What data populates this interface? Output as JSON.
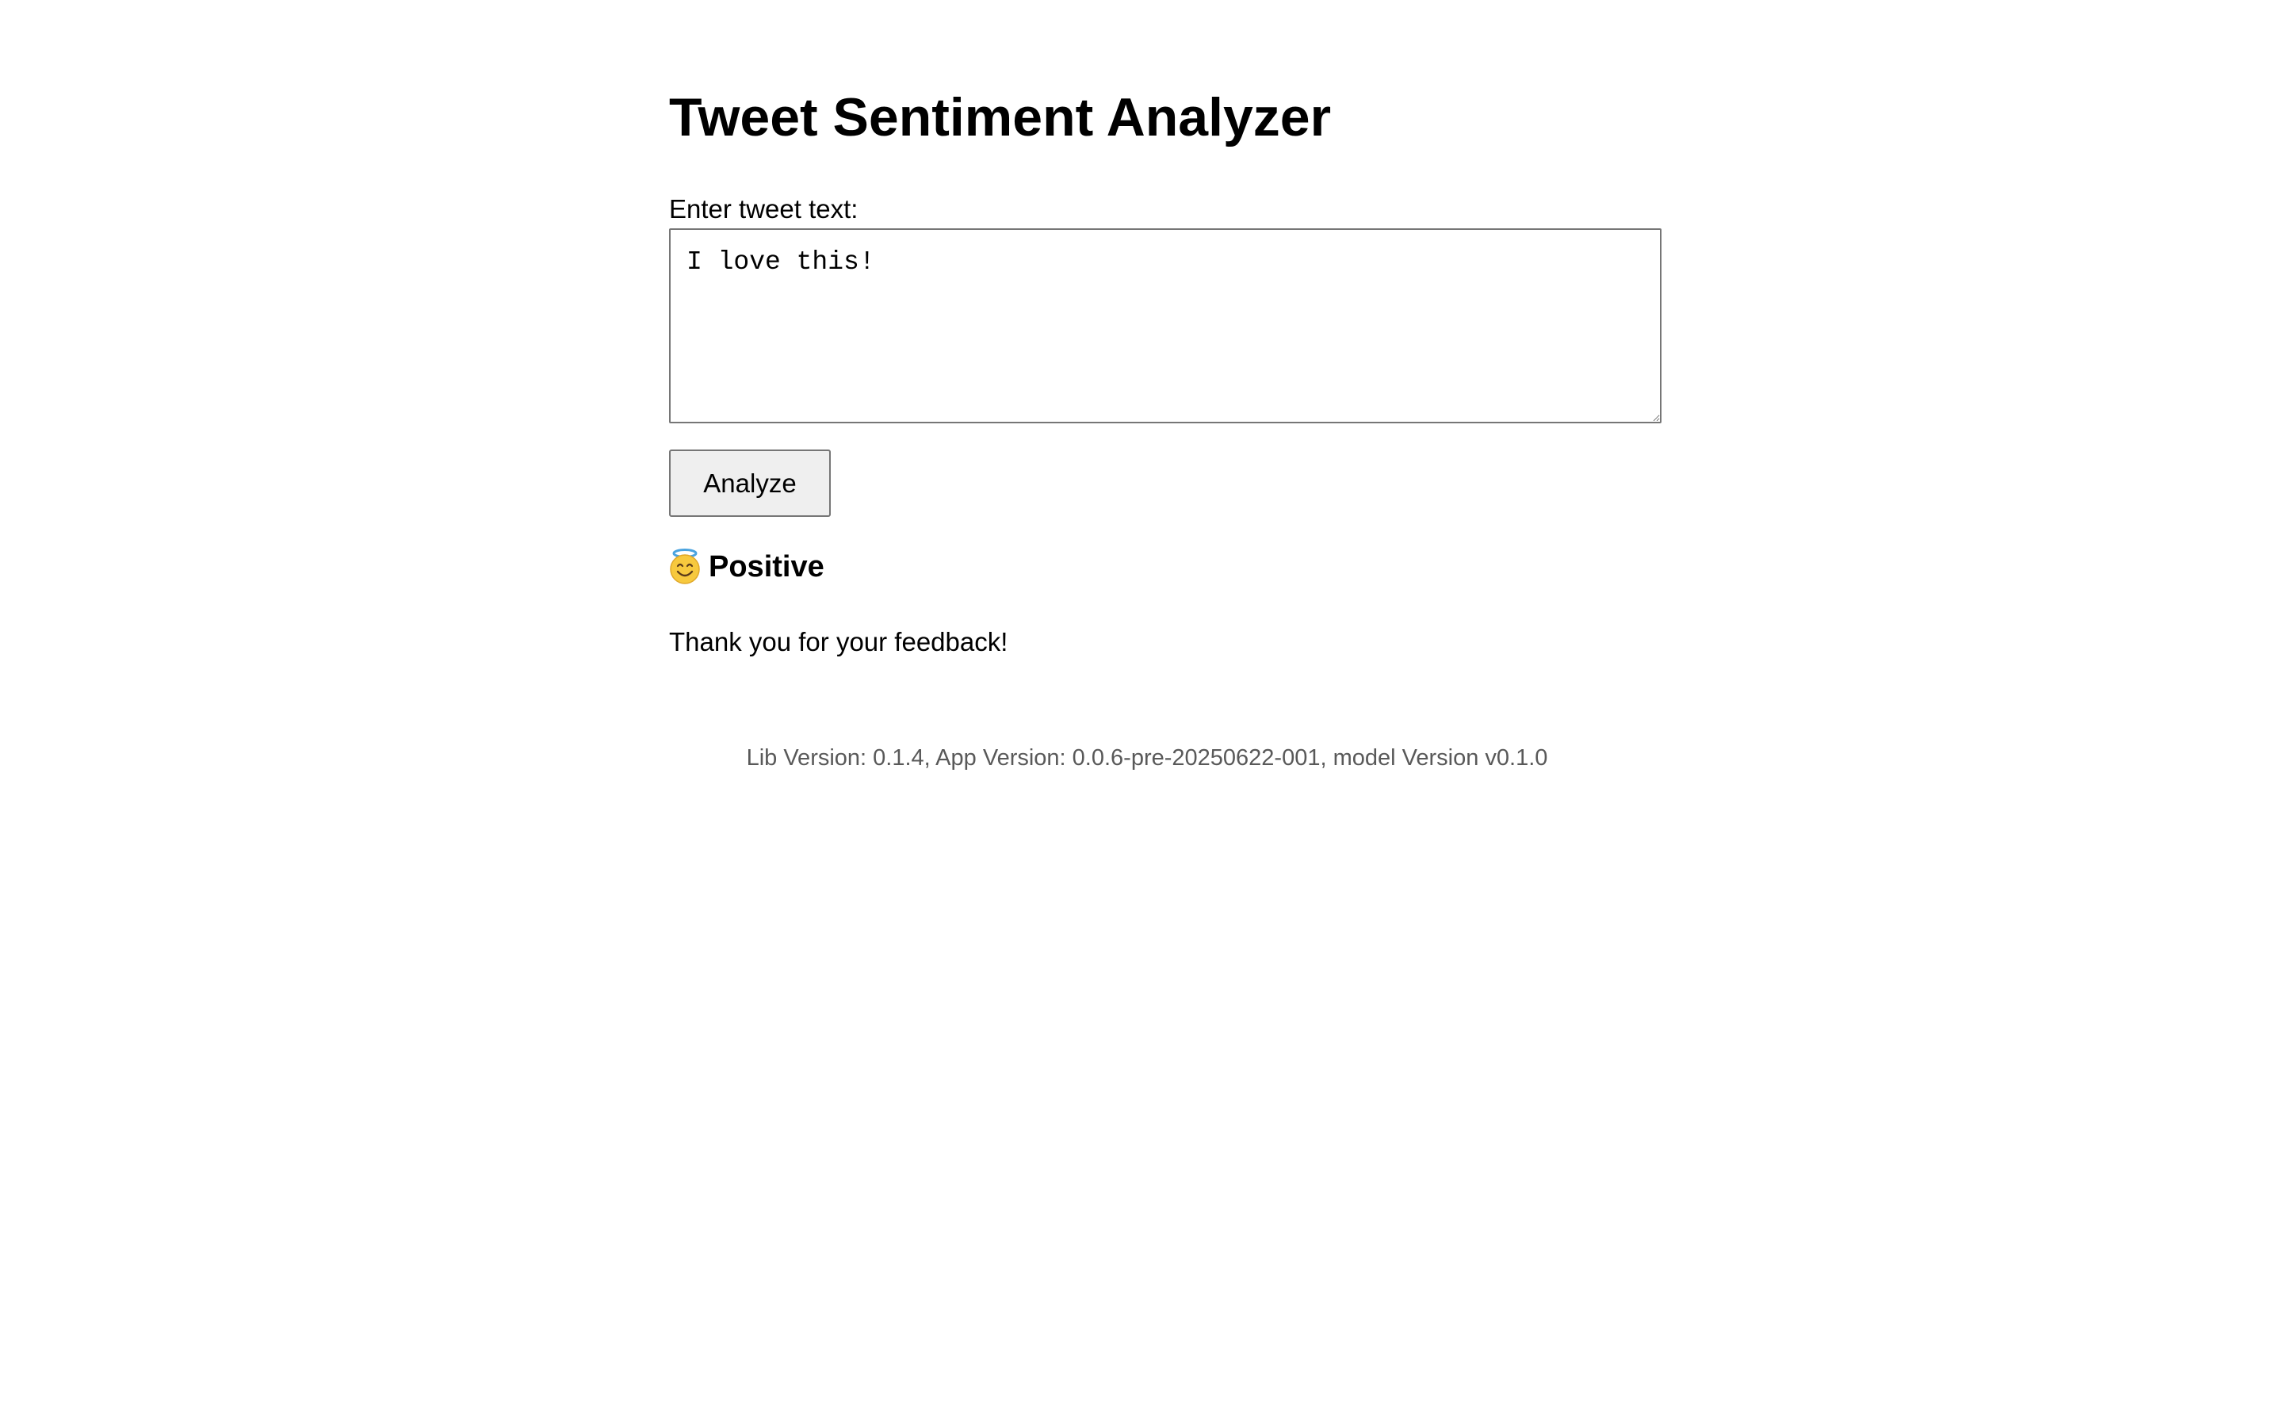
{
  "page": {
    "title": "Tweet Sentiment Analyzer"
  },
  "form": {
    "label": "Enter tweet text:",
    "tweet_value": "I love this!",
    "analyze_label": "Analyze"
  },
  "result": {
    "icon": "smiling-face-with-halo-icon",
    "sentiment": "Positive",
    "message": "Thank you for your feedback!"
  },
  "footer": {
    "version_text": "Lib Version: 0.1.4, App Version: 0.0.6-pre-20250622-001, model Version v0.1.0"
  },
  "colors": {
    "text": "#000000",
    "footer_text": "#595959",
    "button_bg": "#efefef",
    "border": "#767676"
  }
}
